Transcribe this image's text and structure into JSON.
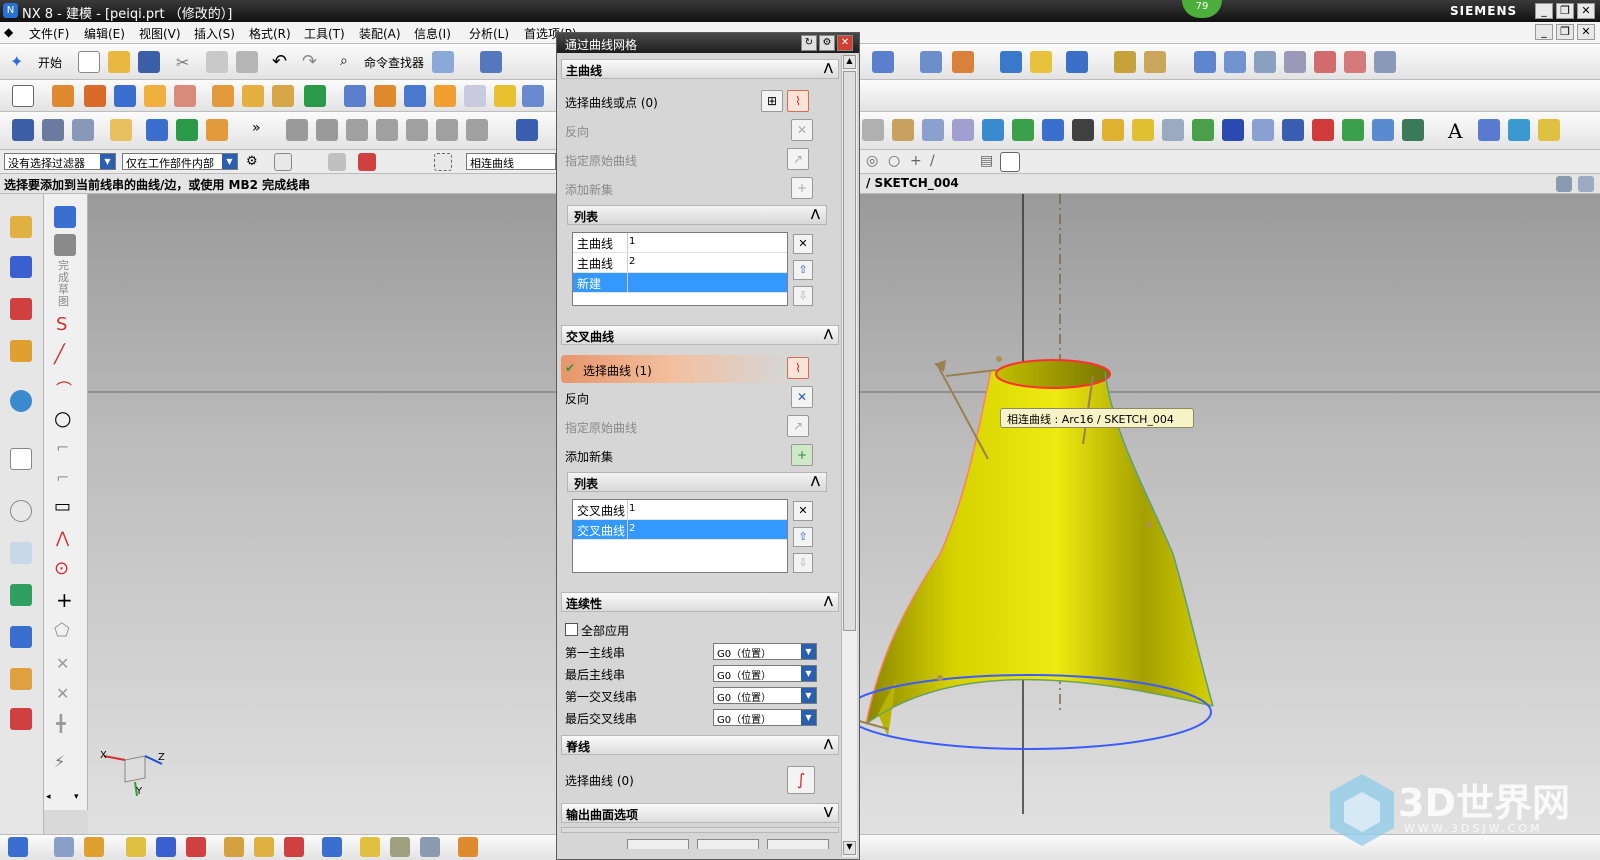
{
  "window": {
    "title": "NX 8 - 建模 - [peiqi.prt （修改的）]",
    "brand": "SIEMENS",
    "badge": "79"
  },
  "menubar": {
    "items": [
      "文件(F)",
      "编辑(E)",
      "视图(V)",
      "插入(S)",
      "格式(R)",
      "工具(T)",
      "装配(A)",
      "信息(I)",
      "分析(L)",
      "首选项(P)"
    ]
  },
  "toolbar1": {
    "start_label": "开始",
    "finder_label": "命令查找器"
  },
  "selbar": {
    "filter": "没有选择过滤器",
    "scope": "仅在工作部件内部",
    "curve_rule": "相连曲线"
  },
  "status": {
    "prompt": "选择要添加到当前线串的曲线/边，或使用 MB2 完成线串",
    "sketch_ref": "/ SKETCH_004"
  },
  "sketch_vertical_label": "完成草图",
  "dialog": {
    "title": "通过曲线网格",
    "primary": {
      "header": "主曲线",
      "select_label": "选择曲线或点 (0)",
      "reverse": "反向",
      "specify_origin": "指定原始曲线",
      "add_new_set": "添加新集",
      "list_header": "列表",
      "list": [
        {
          "name": "主曲线",
          "num": "1"
        },
        {
          "name": "主曲线",
          "num": "2"
        },
        {
          "name": "新建",
          "num": ""
        }
      ]
    },
    "cross": {
      "header": "交叉曲线",
      "select_label": "选择曲线 (1)",
      "reverse": "反向",
      "specify_origin": "指定原始曲线",
      "add_new_set": "添加新集",
      "list_header": "列表",
      "list": [
        {
          "name": "交叉曲线",
          "num": "1"
        },
        {
          "name": "交叉曲线",
          "num": "2"
        }
      ]
    },
    "continuity": {
      "header": "连续性",
      "apply_all": "全部应用",
      "rows": [
        {
          "label": "第一主线串",
          "value": "G0（位置）"
        },
        {
          "label": "最后主线串",
          "value": "G0（位置）"
        },
        {
          "label": "第一交叉线串",
          "value": "G0（位置）"
        },
        {
          "label": "最后交叉线串",
          "value": "G0（位置）"
        }
      ]
    },
    "spine": {
      "header": "脊线",
      "select_label": "选择曲线 (0)"
    },
    "output": {
      "header": "输出曲面选项"
    }
  },
  "viewport": {
    "tooltip": "相连曲线 : Arc16 / SKETCH_004",
    "watermark_text": "3D世界网",
    "watermark_url": "WWW.3DSJW.COM",
    "triad_axes": [
      "X",
      "Y",
      "Z"
    ]
  },
  "colors": {
    "surface": "#d4d000",
    "accent_selected": "#3399ff",
    "highlight_orange": "#e8a070",
    "curve_red": "#ff3030",
    "curve_blue": "#3a5cff"
  }
}
